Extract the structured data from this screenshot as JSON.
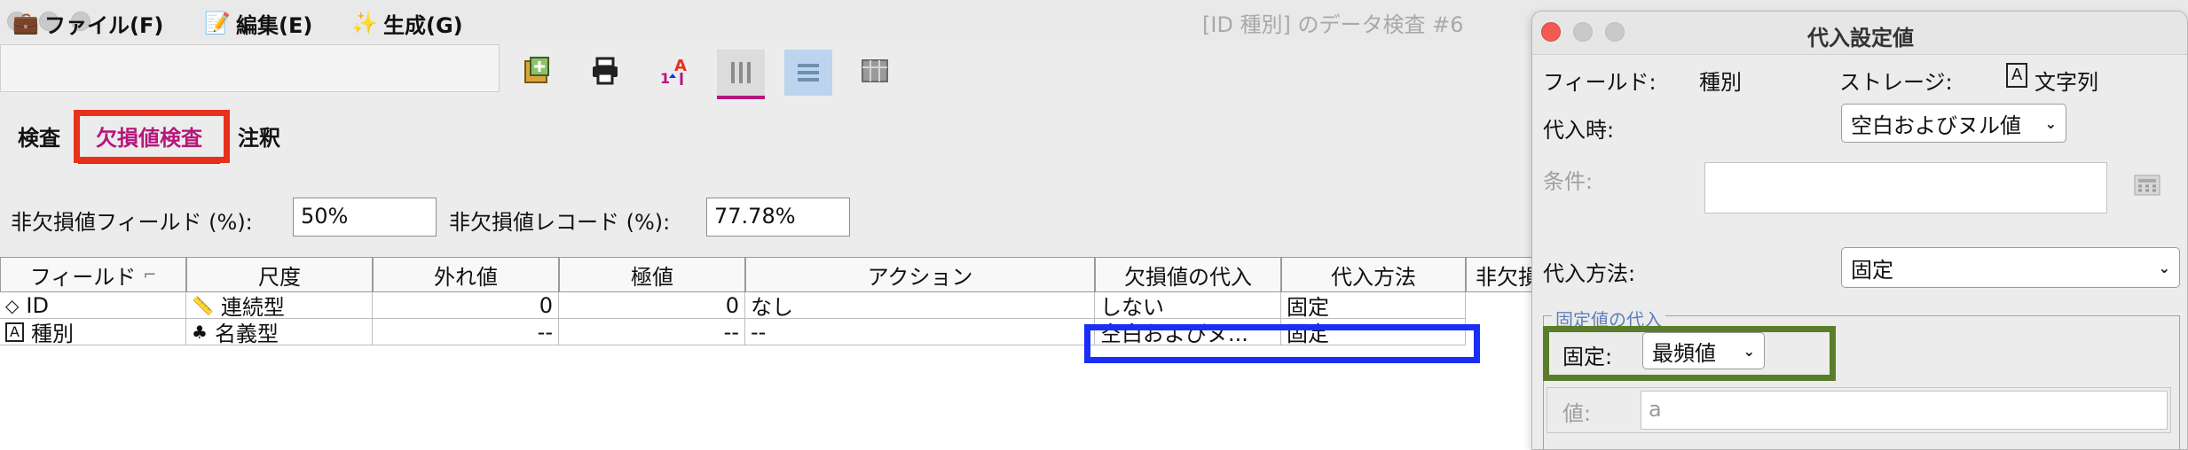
{
  "window": {
    "title": "[ID 種別] のデータ検査 #6"
  },
  "menu": [
    {
      "label": "ファイル(F)",
      "icon": "briefcase-icon"
    },
    {
      "label": "編集(E)",
      "icon": "edit-document-icon"
    },
    {
      "label": "生成(G)",
      "icon": "generate-star-icon"
    }
  ],
  "toolbar": {
    "icons": [
      "generate-node-icon",
      "print-icon",
      "sort-icon",
      "column-view-icon",
      "row-view-icon",
      "table-view-icon"
    ]
  },
  "tabs": [
    {
      "label": "検査",
      "active": false
    },
    {
      "label": "欠損値検査",
      "active": true
    },
    {
      "label": "注釈",
      "active": false
    }
  ],
  "stats": {
    "field_label": "非欠損値フィールド (%):",
    "field_value": "50%",
    "record_label": "非欠損値レコード (%):",
    "record_value": "77.78%"
  },
  "table": {
    "headers": [
      "フィールド",
      "尺度",
      "外れ値",
      "極値",
      "アクション",
      "欠損値の代入",
      "代入方法",
      "非欠損"
    ],
    "rows": [
      {
        "field": "ID",
        "field_icon": "continuous-id-icon",
        "measure": "連続型",
        "measure_icon": "ruler-icon",
        "outliers": "0",
        "extremes": "0",
        "action": "なし",
        "impute": "しない",
        "method": "固定"
      },
      {
        "field": "種別",
        "field_icon": "string-type-icon",
        "measure": "名義型",
        "measure_icon": "nominal-icon",
        "outliers": "--",
        "extremes": "--",
        "action": "--",
        "impute": "空白およびヌ...",
        "method": "固定"
      }
    ]
  },
  "dialog": {
    "title": "代入設定値",
    "field_label": "フィールド:",
    "field_value": "種別",
    "storage_label": "ストレージ:",
    "storage_icon": "A",
    "storage_value": "文字列",
    "impute_when_label": "代入時:",
    "impute_when_value": "空白およびヌル値",
    "condition_label": "条件:",
    "method_label": "代入方法:",
    "method_value": "固定",
    "fixed_group_label": "固定値の代入",
    "fixed_label": "固定:",
    "fixed_value": "最頻値",
    "value_label": "値:",
    "value_value": "a"
  },
  "colors": {
    "accent": "#b5177b",
    "highlight_red": "#e8301c",
    "highlight_blue": "#1a2ef5",
    "highlight_green": "#5a7d2b"
  }
}
